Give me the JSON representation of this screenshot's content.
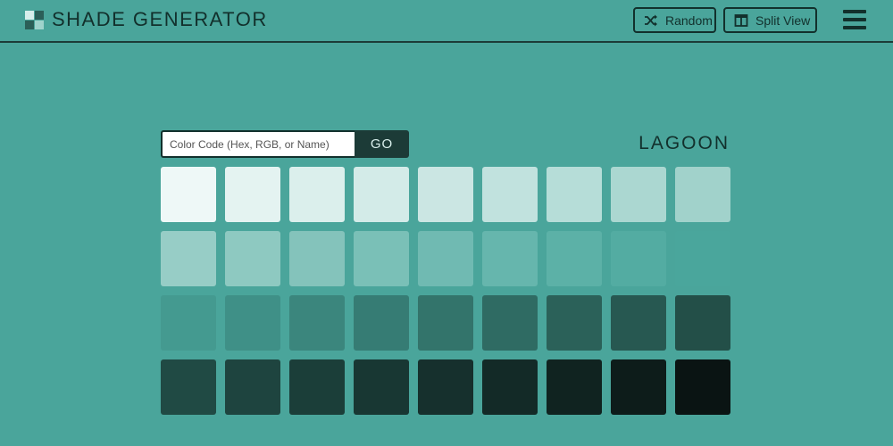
{
  "app": {
    "title": "SHADE GENERATOR",
    "logo_icon": "checker-logo-icon"
  },
  "toolbar": {
    "random": {
      "label": "Random",
      "icon": "shuffle-icon"
    },
    "split_view": {
      "label": "Split View",
      "icon": "split-view-icon"
    },
    "menu_icon": "hamburger-menu-icon"
  },
  "search": {
    "placeholder": "Color Code (Hex, RGB, or Name)",
    "value": "",
    "go_label": "GO"
  },
  "shade_name": "LAGOON",
  "colors": {
    "background": "#4aa59b",
    "dark": "#12302c",
    "go_button": "#1c3b37"
  },
  "shades": [
    [
      "#eef8f7",
      "#e4f3f1",
      "#dbefec",
      "#d3ebe8",
      "#cbe6e3",
      "#c1e2de",
      "#b6ddd8",
      "#abd7d1",
      "#a1d2cb"
    ],
    [
      "#97cdc6",
      "#8ec9c1",
      "#84c3bb",
      "#7ac0b7",
      "#70bab2",
      "#66b6ad",
      "#5cb1a7",
      "#53aca2",
      "#4aa69c"
    ],
    [
      "#449a90",
      "#3f9087",
      "#3b867d",
      "#367c74",
      "#33746b",
      "#2f6b63",
      "#2b6159",
      "#275851",
      "#234f48"
    ],
    [
      "#204a44",
      "#1e443f",
      "#1b3e39",
      "#183733",
      "#16302d",
      "#132a27",
      "#102320",
      "#0d1c1a",
      "#0a1413"
    ]
  ]
}
